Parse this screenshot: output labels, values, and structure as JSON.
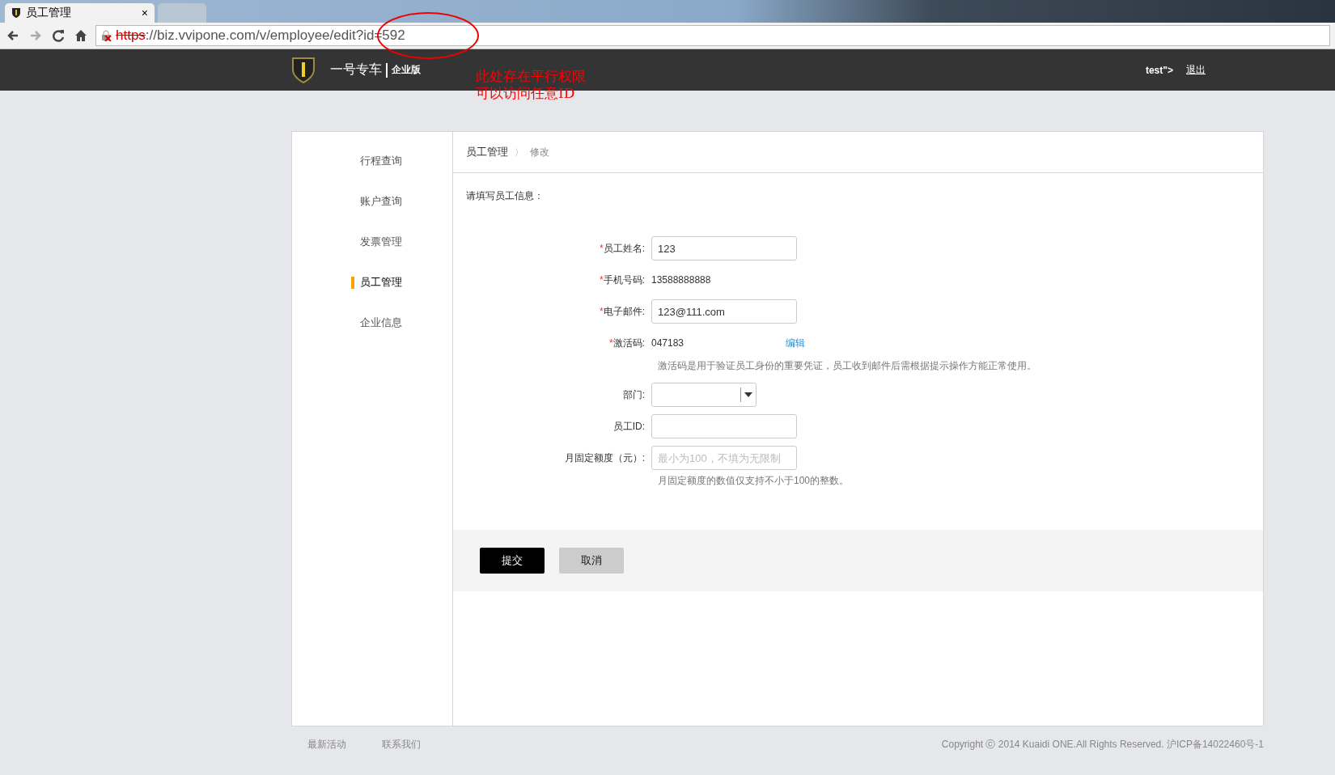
{
  "browser": {
    "tabs": [
      {
        "title": "员工管理",
        "close": "×",
        "selected": true
      },
      {
        "selected": false
      }
    ],
    "url": {
      "scheme": "https",
      "rest": "://biz.vvipone.com/v/employee/edit?id=592"
    }
  },
  "header": {
    "brand": "一号专车",
    "edition": "企业版",
    "user": "test\">",
    "logout": "退出"
  },
  "annotation": {
    "lines": [
      "此处存在平行权限",
      "可以访问任意ID"
    ]
  },
  "sidebar": {
    "items": [
      {
        "label": "行程查询",
        "selected": false
      },
      {
        "label": "账户查询",
        "selected": false
      },
      {
        "label": "发票管理",
        "selected": false
      },
      {
        "label": "员工管理",
        "selected": true
      },
      {
        "label": "企业信息",
        "selected": false
      }
    ]
  },
  "breadcrumb": {
    "parent": "员工管理",
    "separator": "〉",
    "current": "修改"
  },
  "form": {
    "intro": "请填写员工信息：",
    "fields": [
      {
        "kind": "input",
        "mark": "*",
        "label": "员工姓名:",
        "value": "123"
      },
      {
        "kind": "text",
        "mark": "*",
        "label": "手机号码:",
        "value": "13588888888"
      },
      {
        "kind": "input",
        "mark": "*",
        "label": "电子邮件:",
        "value": "123@111.com"
      },
      {
        "kind": "text",
        "mark": "*",
        "label": "激活码:",
        "value": "047183",
        "link": "编辑",
        "hint": "激活码是用于验证员工身份的重要凭证，员工收到邮件后需根据提示操作方能正常使用。"
      },
      {
        "kind": "select",
        "label": "部门:"
      },
      {
        "kind": "input",
        "label": "员工ID:"
      },
      {
        "kind": "input",
        "label": "月固定额度（元）:",
        "placeholder": "最小为100，不填为无限制",
        "hint": "月固定额度的数值仅支持不小于100的整数。"
      }
    ]
  },
  "buttons": [
    {
      "label": "提交",
      "kind": "primary"
    },
    {
      "label": "取消",
      "kind": "secondary"
    }
  ],
  "footer": {
    "links": [
      "最新活动",
      "联系我们"
    ],
    "copyright": "Copyright ⓒ 2014 Kuaidi ONE.All Rights Reserved. 沪ICP备14022460号-1"
  }
}
